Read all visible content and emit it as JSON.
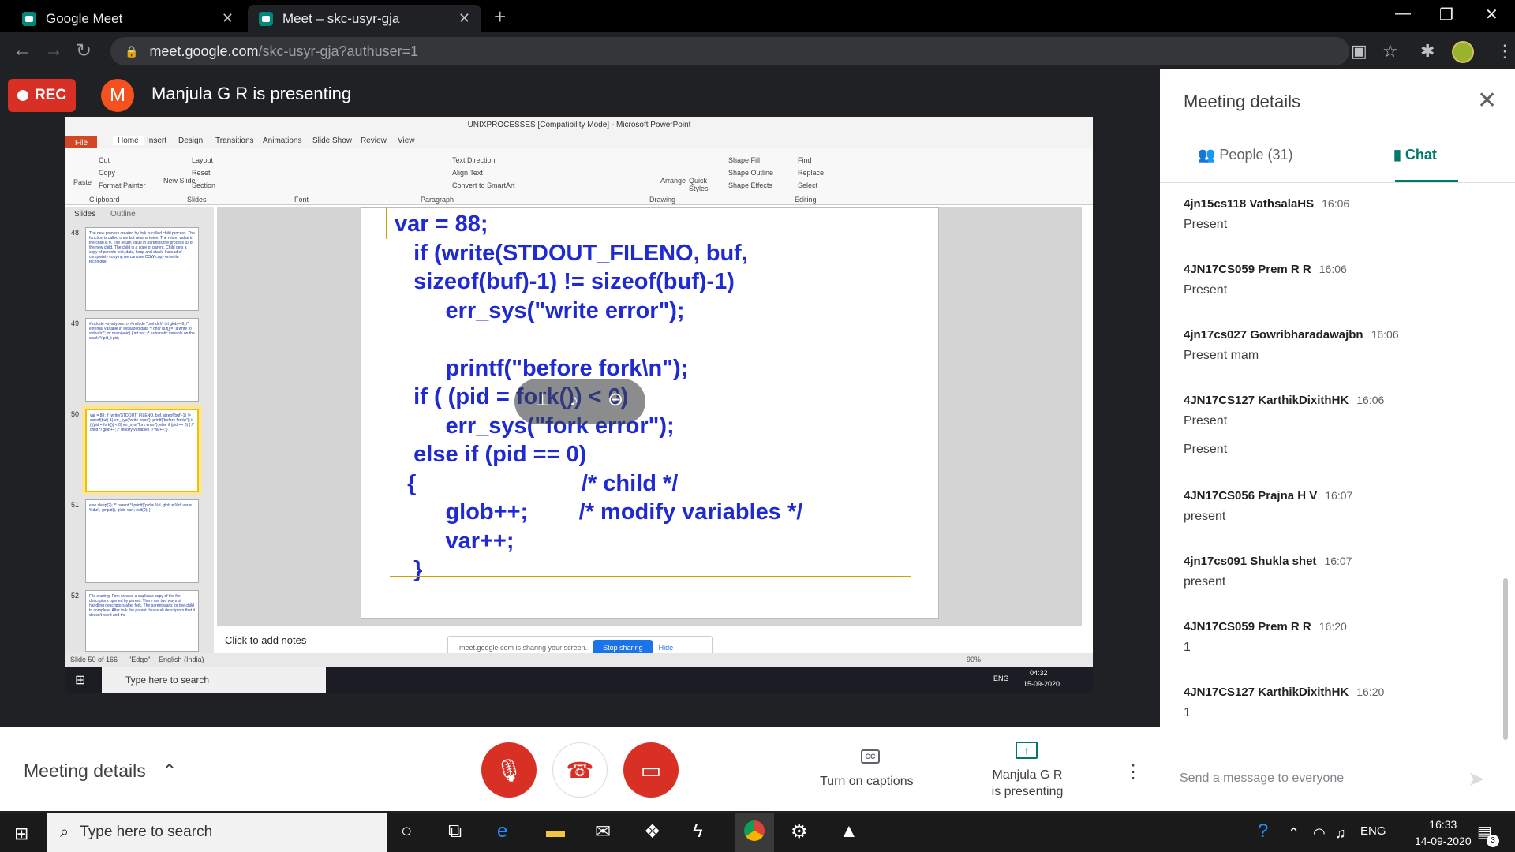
{
  "browser": {
    "tabs": [
      {
        "label": "Google Meet",
        "close": "✕"
      },
      {
        "label": "Meet – skc-usyr-gja",
        "close": "✕"
      }
    ],
    "new_tab": "+",
    "window_controls": {
      "minimize": "—",
      "maximize": "❐",
      "close": "✕"
    },
    "url_host": "meet.google.com",
    "url_path": "/skc-usyr-gja?authuser=1"
  },
  "meet_header": {
    "rec_label": "REC",
    "presenter_initial": "M",
    "presenting_text": "Manjula G R is presenting"
  },
  "powerpoint": {
    "title": "UNIXPROCESSES [Compatibility Mode]  -  Microsoft PowerPoint",
    "ribbon_tabs": [
      "File",
      "Home",
      "Insert",
      "Design",
      "Transitions",
      "Animations",
      "Slide Show",
      "Review",
      "View"
    ],
    "ribbon_items": {
      "cut": "Cut",
      "copy": "Copy",
      "format_painter": "Format Painter",
      "paste": "Paste",
      "clipboard": "Clipboard",
      "new_slide": "New Slide",
      "layout": "Layout",
      "reset": "Reset",
      "section": "Section",
      "slides": "Slides",
      "font": "Font",
      "paragraph": "Paragraph",
      "text_direction": "Text Direction",
      "align_text": "Align Text",
      "convert_smartart": "Convert to SmartArt",
      "drawing": "Drawing",
      "arrange": "Arrange",
      "quick_styles": "Quick Styles",
      "shape_fill": "Shape Fill",
      "shape_outline": "Shape Outline",
      "shape_effects": "Shape Effects",
      "find": "Find",
      "replace": "Replace",
      "select": "Select",
      "editing": "Editing"
    },
    "pane_tabs": [
      "Slides",
      "Outline"
    ],
    "thumbnails": [
      {
        "num": "48",
        "text": "The new process created by fork is called child process. The function is called once but returns twice. The return value in the child is 0. The return value in parent is the process ID of the new child. The child is a copy of parent. Child gets a copy of parents text, data, heap and stack. Instead of completely copying we can use COW copy on write technique"
      },
      {
        "num": "49",
        "text": "#include <sys/types.h> #include \"ourhdr.h\" int glob = 6; /* external variable in initialized data */ char buf[] = \"a write to stdout\\n\"; int main(void) { int var; /* automatic variable on the stack */ pid_t pid;"
      },
      {
        "num": "50",
        "text": "var = 88; if (write(STDOUT_FILENO, buf, sizeof(buf)-1) != sizeof(buf)-1) err_sys(\"write error\"); printf(\"before fork\\n\"); if ( (pid = fork()) < 0) err_sys(\"fork error\"); else if (pid == 0) { /* child */ glob++; /* modify variables */ var++; }"
      },
      {
        "num": "51",
        "text": "else sleep(2); /* parent */ printf(\"pid = %d, glob = %d, var = %d\\n\", getpid(), glob, var); exit(0); }"
      },
      {
        "num": "52",
        "text": "File sharing. Fork creates a duplicate copy of the file descriptors opened by parent. There are two ways of handling descriptors after fork. The parent waits for the child to complete. After fork the parent closes all descriptors that it doesn't need and the"
      }
    ],
    "slide_code": "var = 88;\n   if (write(STDOUT_FILENO, buf,\n   sizeof(buf)-1) != sizeof(buf)-1)\n        err_sys(\"write error\");\n\n        printf(\"before fork\\n\");\n   if ( (pid = fork()) < 0)\n        err_sys(\"fork error\");\n   else if (pid == 0)\n  {                          /* child */\n        glob++;        /* modify variables */\n        var++;\n   }",
    "notes_placeholder": "Click to add notes",
    "status_slide": "Slide 50 of 166",
    "status_theme": "\"Edge\"",
    "status_lang": "English (India)",
    "status_zoom": "90%",
    "share_notice": "meet.google.com is sharing your screen.",
    "stop_sharing": "Stop sharing",
    "hide": "Hide",
    "inner_search": "Type here to search",
    "inner_lang": "ENG",
    "inner_time": "04:32",
    "inner_date": "15-09-2020"
  },
  "panel": {
    "title": "Meeting details",
    "tab_people": "People (31)",
    "tab_chat": "Chat",
    "messages": [
      {
        "sender": "4jn15cs118 VathsalaHS",
        "time": "16:06",
        "texts": [
          "Present"
        ]
      },
      {
        "sender": "4JN17CS059 Prem R R",
        "time": "16:06",
        "texts": [
          "Present"
        ]
      },
      {
        "sender": "4jn17cs027 Gowribharadawajbn",
        "time": "16:06",
        "texts": [
          "Present mam"
        ]
      },
      {
        "sender": "4JN17CS127 KarthikDixithHK",
        "time": "16:06",
        "texts": [
          "Present",
          "Present"
        ]
      },
      {
        "sender": "4JN17CS056 Prajna H V",
        "time": "16:07",
        "texts": [
          "present"
        ]
      },
      {
        "sender": "4jn17cs091 Shukla shet",
        "time": "16:07",
        "texts": [
          "present"
        ]
      },
      {
        "sender": "4JN17CS059 Prem R R",
        "time": "16:20",
        "texts": [
          "1"
        ]
      },
      {
        "sender": "4JN17CS127 KarthikDixithHK",
        "time": "16:20",
        "texts": [
          "1"
        ]
      }
    ],
    "send_placeholder": "Send a message to everyone"
  },
  "bottom": {
    "meeting_details": "Meeting details",
    "captions": "Turn on captions",
    "cc": "CC",
    "presenter_line1": "Manjula G R",
    "presenter_line2": "is presenting"
  },
  "taskbar": {
    "search": "Type here to search",
    "lang": "ENG",
    "time": "16:33",
    "date": "14-09-2020",
    "notif_count": "3"
  }
}
